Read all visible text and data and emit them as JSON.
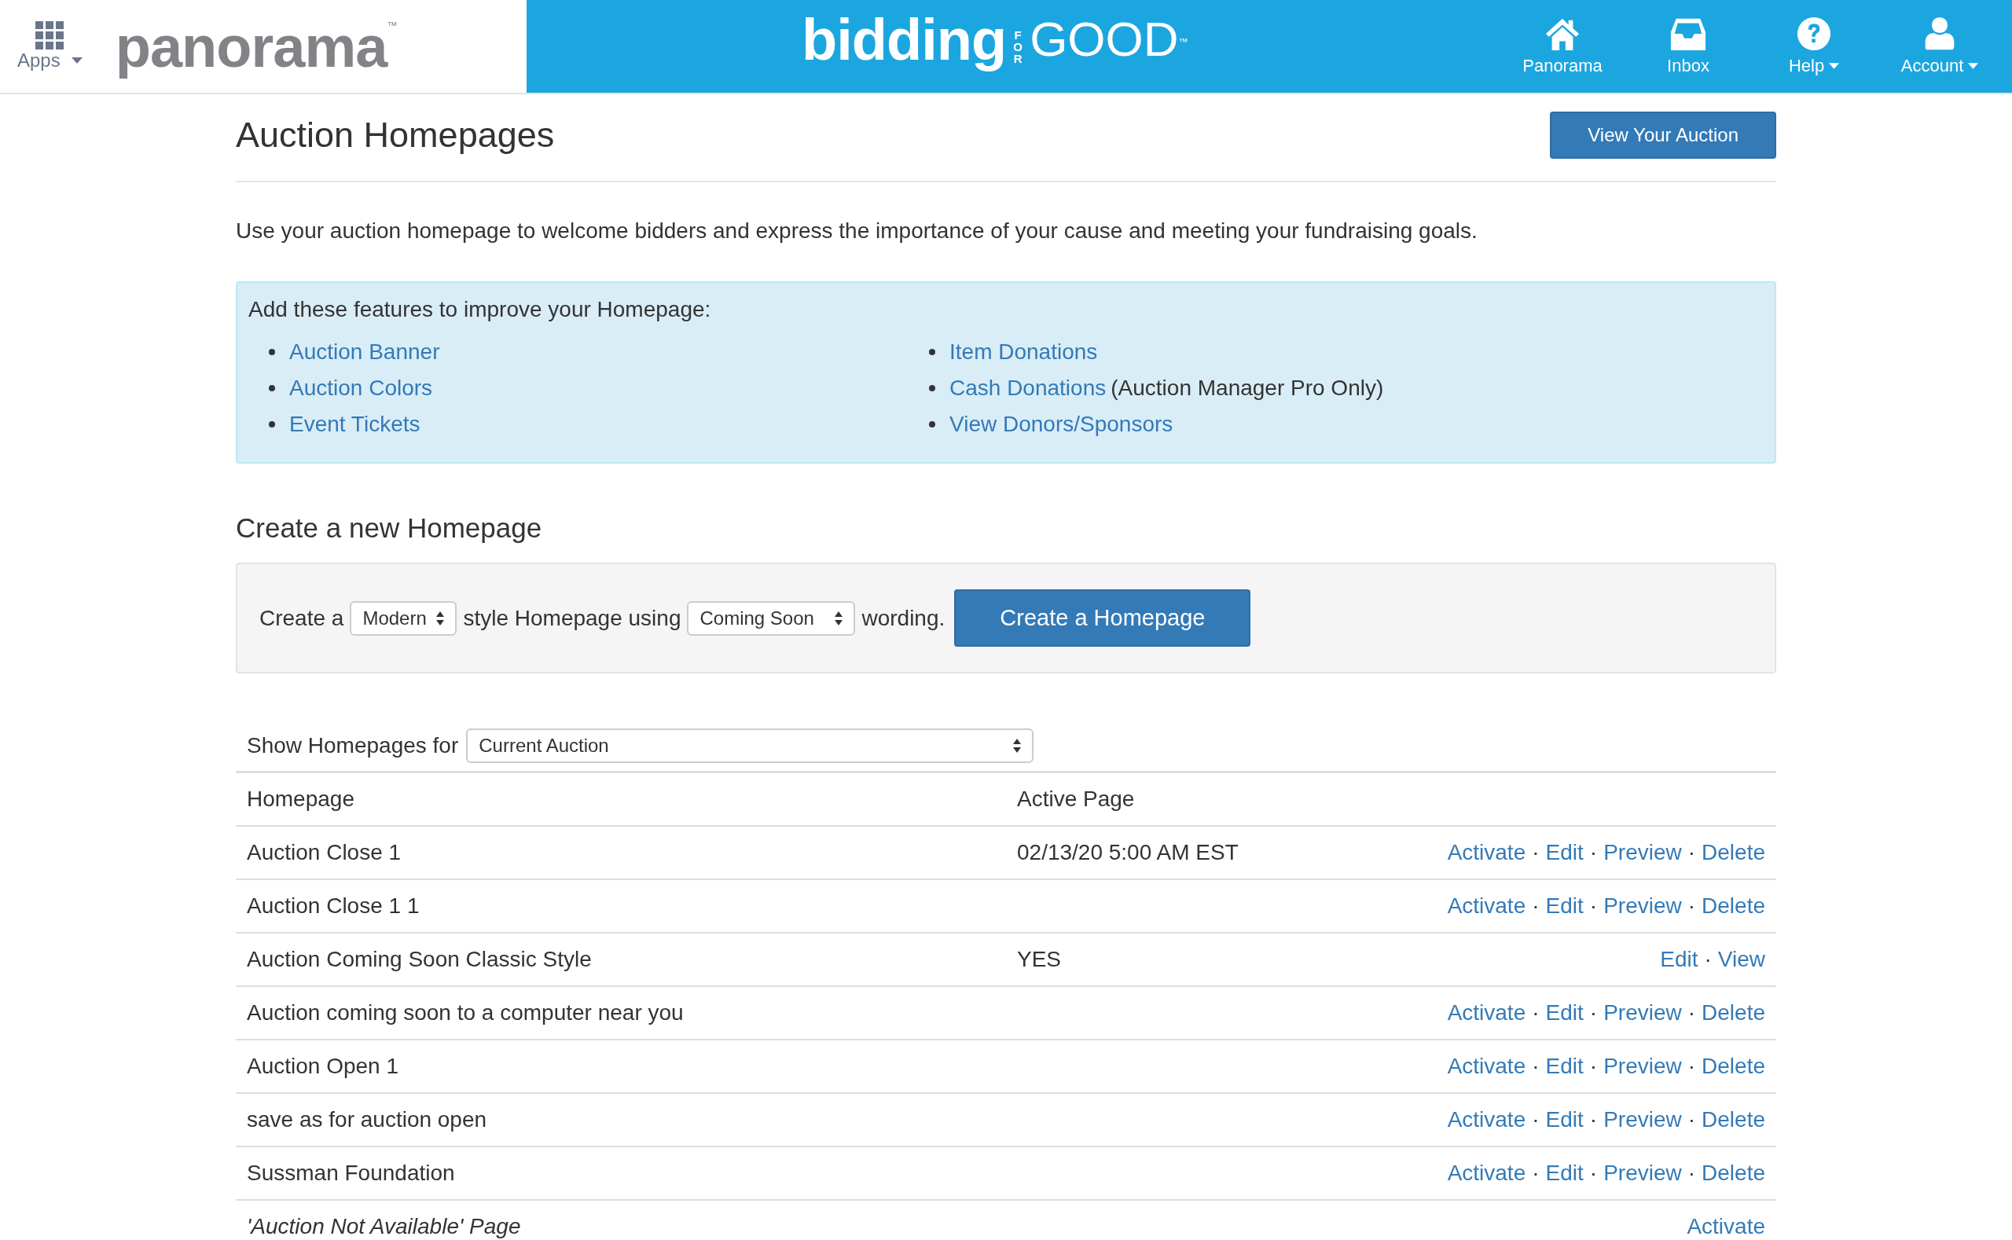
{
  "header": {
    "apps_label": "Apps",
    "brand_logo": {
      "text": "panorama",
      "mark": "™"
    },
    "center_logo": {
      "word": "bidding",
      "small": "FOR",
      "big": "GOOD",
      "mark": "™"
    },
    "nav": [
      {
        "kind": "home",
        "label": "Panorama",
        "dropdown": false
      },
      {
        "kind": "inbox",
        "label": "Inbox",
        "dropdown": false
      },
      {
        "kind": "help",
        "label": "Help",
        "dropdown": true
      },
      {
        "kind": "account",
        "label": "Account",
        "dropdown": true
      }
    ]
  },
  "page": {
    "title": "Auction Homepages",
    "view_button": "View Your Auction",
    "intro": "Use your auction homepage to welcome bidders and express the importance of your cause and meeting your fundraising goals.",
    "features": {
      "heading": "Add these features to improve your Homepage:",
      "columns": [
        [
          {
            "link": "Auction Banner"
          },
          {
            "link": "Auction Colors"
          },
          {
            "link": "Event Tickets"
          }
        ],
        [
          {
            "link": "Item Donations"
          },
          {
            "link": "Cash Donations",
            "note": "(Auction Manager Pro Only)"
          },
          {
            "link": "View Donors/Sponsors"
          }
        ]
      ]
    },
    "create": {
      "heading": "Create a new Homepage",
      "text_1": "Create a",
      "style_select": "Modern",
      "text_2": "style Homepage using",
      "wording_select": "Coming Soon",
      "text_3": "wording.",
      "button": "Create a Homepage"
    },
    "filter": {
      "label": "Show Homepages for",
      "select": "Current Auction"
    },
    "table": {
      "columns": [
        "Homepage",
        "Active Page"
      ],
      "separator": "·",
      "rows": [
        {
          "kind": "normal",
          "homepage": "Auction Close 1",
          "active": "02/13/20 5:00 AM EST",
          "actions": [
            "Activate",
            "Edit",
            "Preview",
            "Delete"
          ]
        },
        {
          "kind": "normal",
          "homepage": "Auction Close 1 1",
          "actions": [
            "Activate",
            "Edit",
            "Preview",
            "Delete"
          ]
        },
        {
          "kind": "normal",
          "homepage": "Auction Coming Soon Classic Style",
          "active": "YES",
          "actions": [
            "Edit",
            "View"
          ]
        },
        {
          "kind": "normal",
          "homepage": "Auction coming soon to a computer near you",
          "actions": [
            "Activate",
            "Edit",
            "Preview",
            "Delete"
          ]
        },
        {
          "kind": "normal",
          "homepage": "Auction Open 1",
          "actions": [
            "Activate",
            "Edit",
            "Preview",
            "Delete"
          ]
        },
        {
          "kind": "normal",
          "homepage": "save as for auction open",
          "actions": [
            "Activate",
            "Edit",
            "Preview",
            "Delete"
          ]
        },
        {
          "kind": "normal",
          "homepage": "Sussman Foundation",
          "actions": [
            "Activate",
            "Edit",
            "Preview",
            "Delete"
          ]
        },
        {
          "kind": "special",
          "homepage": "'Auction Not Available' Page",
          "actions": [
            "Activate"
          ]
        }
      ]
    }
  }
}
